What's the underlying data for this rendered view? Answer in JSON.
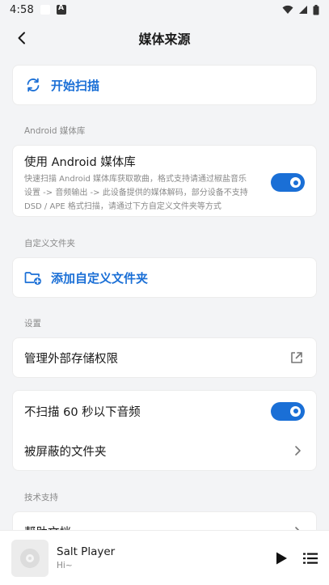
{
  "status_bar": {
    "time": "4:58"
  },
  "app_bar": {
    "title": "媒体来源"
  },
  "scan": {
    "label": "开始扫描"
  },
  "sections": {
    "android_library": "Android 媒体库",
    "custom_folder": "自定义文件夹",
    "settings": "设置",
    "support": "技术支持"
  },
  "android_library": {
    "title": "使用 Android 媒体库",
    "description_lines": [
      "快速扫描 Android 媒体库获取歌曲，格式支持请通过椒盐音乐",
      "设置 -> 音频输出 -> 此设备提供的媒体解码，部分设备不支持",
      "DSD / APE 格式扫描，请通过下方自定义文件夹等方式"
    ],
    "enabled": true
  },
  "custom_folder": {
    "add_label": "添加自定义文件夹"
  },
  "settings": {
    "storage_permission": "管理外部存储权限",
    "skip_short": "不扫描 60 秒以下音频",
    "skip_short_enabled": true,
    "blocked_folders": "被屏蔽的文件夹"
  },
  "support": {
    "help_docs": "帮助文档"
  },
  "player": {
    "track_title": "Salt Player",
    "track_artist": "Hi~"
  },
  "colors": {
    "accent": "#1a6fd6",
    "background": "#f3f4f6",
    "card": "#ffffff"
  },
  "icons": {
    "back": "chevron-left-icon",
    "scan": "refresh-icon",
    "add_folder": "folder-plus-icon",
    "external": "open-external-icon",
    "chevron": "chevron-right-icon",
    "play": "play-icon",
    "queue": "playlist-icon"
  }
}
